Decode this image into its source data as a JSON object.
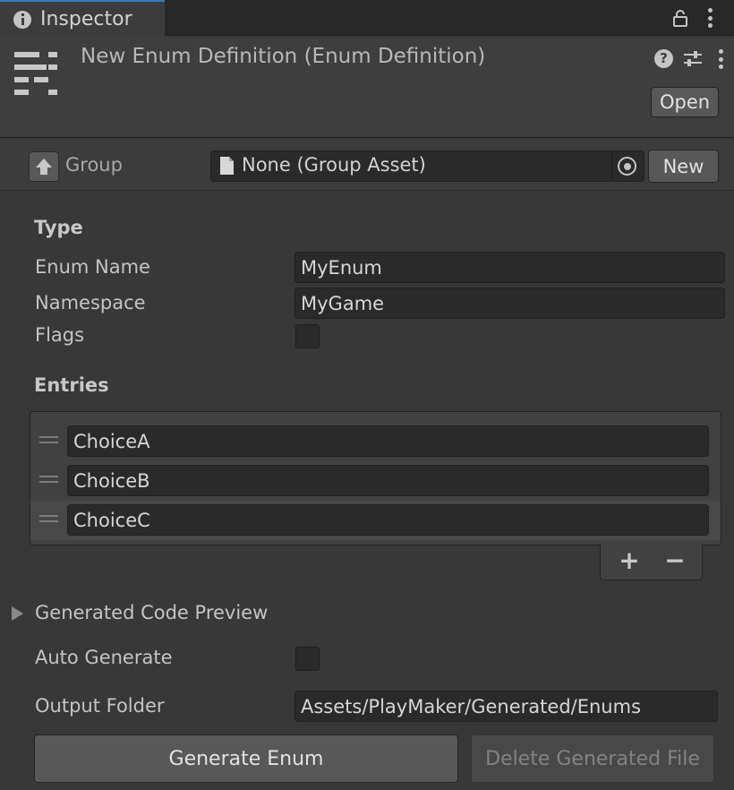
{
  "tab": {
    "label": "Inspector"
  },
  "header": {
    "title": "New Enum Definition (Enum Definition)",
    "open_label": "Open",
    "help_glyph": "?"
  },
  "group": {
    "label": "Group",
    "field_value": "None (Group Asset)",
    "new_label": "New"
  },
  "type_section": {
    "title": "Type",
    "enum_name_label": "Enum Name",
    "enum_name_value": "MyEnum",
    "namespace_label": "Namespace",
    "namespace_value": "MyGame",
    "flags_label": "Flags",
    "flags_checked": false
  },
  "entries": {
    "title": "Entries",
    "items": [
      "ChoiceA",
      "ChoiceB",
      "ChoiceC"
    ],
    "add_glyph": "+",
    "remove_glyph": "−"
  },
  "preview": {
    "label": "Generated Code Preview",
    "expanded": false
  },
  "output": {
    "auto_generate_label": "Auto Generate",
    "auto_generate_checked": false,
    "output_folder_label": "Output Folder",
    "output_folder_value": "Assets/PlayMaker/Generated/Enums"
  },
  "actions": {
    "generate_label": "Generate Enum",
    "delete_label": "Delete Generated File"
  },
  "icons": {
    "tab": "info-icon",
    "lock": "lock-icon",
    "menu": "kebab-menu-icon",
    "enum": "enum-definition-icon",
    "help": "help-icon",
    "presets": "sliders-icon",
    "up": "arrow-up-icon",
    "doc": "document-icon",
    "picker": "object-picker-icon",
    "drag": "drag-handle-icon",
    "foldout": "triangle-right-icon"
  },
  "colors": {
    "background": "#383838",
    "tab_accent": "#3a79bb",
    "field_bg": "#2a2a2a",
    "button_bg": "#585858"
  }
}
